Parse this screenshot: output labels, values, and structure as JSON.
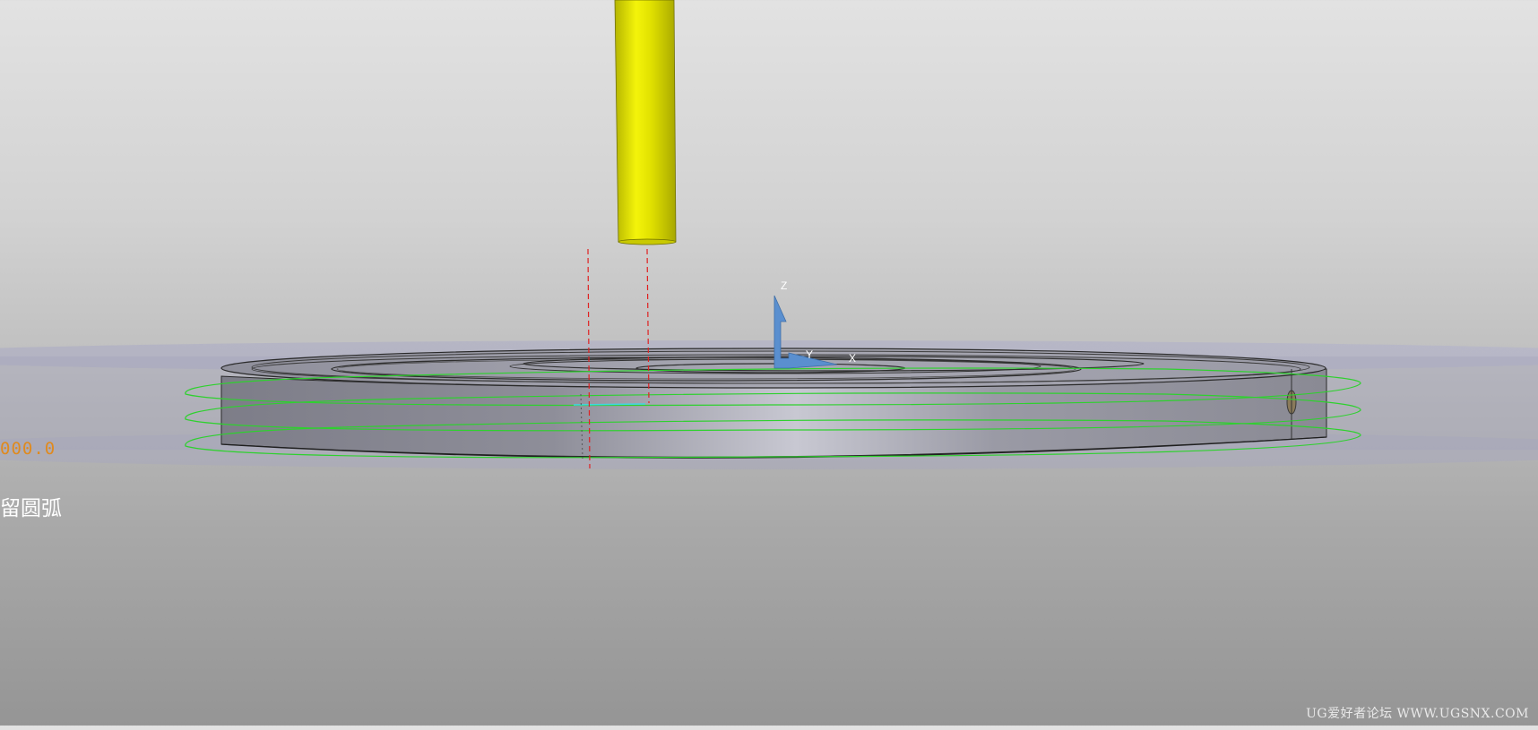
{
  "viewport": {
    "dimension_value": "000.0",
    "status_text": "留圆弧",
    "watermark": "UG爱好者论坛 WWW.UGSNX.COM"
  },
  "csys": {
    "z_label": "Z",
    "x_label": "X",
    "y_label": "Y"
  },
  "colors": {
    "tool": "#d8d800",
    "toolpath_green": "#2ed12e",
    "toolpath_red": "#e02020",
    "csys_blue": "#5a8fcf",
    "workpiece": "#8a8a95",
    "dimension_orange": "#e08a1e"
  },
  "objects": {
    "tool": "cylinder-tool",
    "workpiece": "disc-part"
  }
}
